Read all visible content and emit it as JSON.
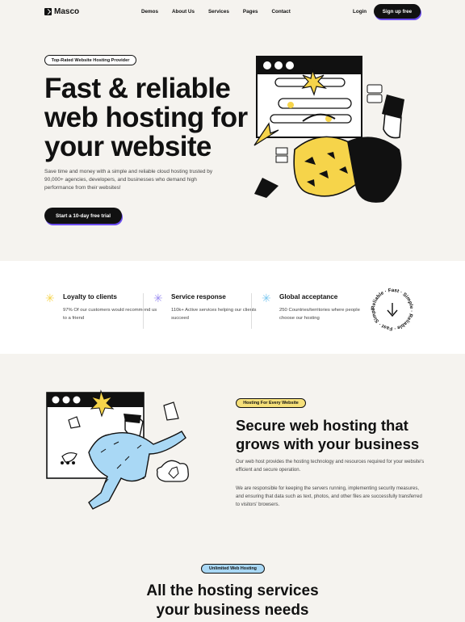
{
  "brand": {
    "name": "Masco"
  },
  "nav": {
    "items": [
      "Demos",
      "About Us",
      "Services",
      "Pages",
      "Contact"
    ],
    "login": "Login",
    "signup": "Sign up free"
  },
  "hero": {
    "badge": "Top-Rated Website Hosting Provider",
    "title_lines": [
      "Fast & reliable",
      "web hosting for",
      "your website"
    ],
    "description": "Save time and money with a simple and reliable cloud hosting trusted by 90,000+ agencies, developers, and businesses who demand high performance from their websites!",
    "cta": "Start a 10-day free trial"
  },
  "features": [
    {
      "icon": "yellow-sparkle-icon",
      "color": "#f6d44a",
      "title": "Loyalty to clients",
      "desc": "97% Of our customers would recommend us to a friend"
    },
    {
      "icon": "purple-sparkle-icon",
      "color": "#9b8cf2",
      "title": "Service response",
      "desc": "110k+ Active services helping our clients succeed"
    },
    {
      "icon": "blue-sparkle-icon",
      "color": "#7cc8f0",
      "title": "Global acceptance",
      "desc": "250 Countries/territories where people choose our hosting"
    }
  ],
  "circle_badge": {
    "text": "Reliable · Fast · Simple · Reliable · Fast · Simple ·"
  },
  "section2": {
    "badge": "Hosting For Every Website",
    "title_lines": [
      "Secure web hosting that",
      "grows with your business"
    ],
    "p1": "Our web host provides the hosting technology and resources required for your website's efficient and secure operation.",
    "p2": "We are responsible for keeping the servers running, implementing security measures, and ensuring that data such as text, photos, and other files are successfully transferred to visitors' browsers."
  },
  "section3": {
    "badge": "Unlimited Web Hosting",
    "title_lines": [
      "All the hosting services",
      "your business needs"
    ]
  },
  "colors": {
    "accent": "#6b4cf0",
    "yellow": "#f6d44a",
    "blue": "#a9d8f5",
    "dark": "#111111"
  }
}
